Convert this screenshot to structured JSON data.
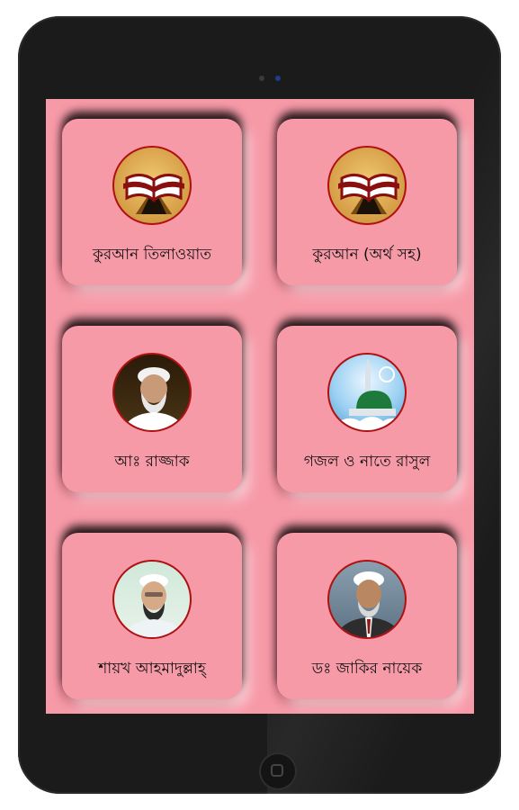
{
  "device": {
    "frame_color": "#1b1b1b",
    "screen_color": "#f79aa8"
  },
  "menu": {
    "items": [
      {
        "label": "কুরআন তিলাওয়াত",
        "icon": "quran-book-icon"
      },
      {
        "label": "কুরআন (অর্থ সহ)",
        "icon": "quran-book-icon"
      },
      {
        "label": "আঃ রাজ্জাক",
        "icon": "scholar-portrait-icon"
      },
      {
        "label": "গজল ও নাতে রাসুল",
        "icon": "mosque-icon"
      },
      {
        "label": "শায়খ আহমাদুল্লাহ্",
        "icon": "scholar-portrait-icon"
      },
      {
        "label": "ডঃ জাকির নায়েক",
        "icon": "scholar-portrait-icon"
      }
    ]
  }
}
